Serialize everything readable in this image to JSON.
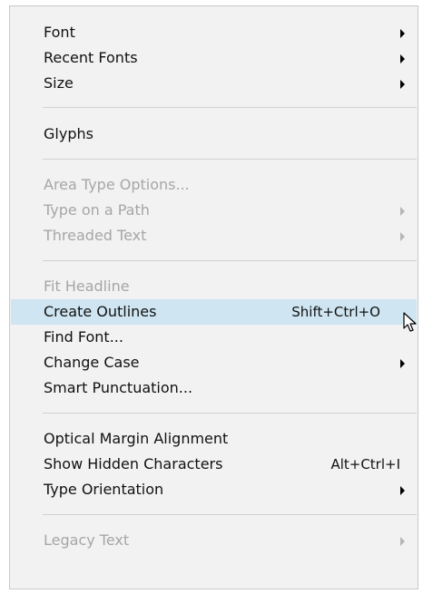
{
  "menu": {
    "font": "Font",
    "recent_fonts": "Recent Fonts",
    "size": "Size",
    "glyphs": "Glyphs",
    "area_type_options": "Area Type Options...",
    "type_on_a_path": "Type on a Path",
    "threaded_text": "Threaded Text",
    "fit_headline": "Fit Headline",
    "create_outlines": "Create Outlines",
    "create_outlines_shortcut": "Shift+Ctrl+O",
    "find_font": "Find Font...",
    "change_case": "Change Case",
    "smart_punctuation": "Smart Punctuation...",
    "optical_margin_alignment": "Optical Margin Alignment",
    "show_hidden_characters": "Show Hidden Characters",
    "show_hidden_characters_shortcut": "Alt+Ctrl+I",
    "type_orientation": "Type Orientation",
    "legacy_text": "Legacy Text"
  },
  "colors": {
    "menu_background": "#f2f2f2",
    "highlight": "#cfe6f2",
    "disabled_text": "#a6a6a6",
    "text": "#111111"
  },
  "icons": {
    "submenu": "submenu-arrow-icon",
    "cursor": "mouse-pointer-icon"
  }
}
